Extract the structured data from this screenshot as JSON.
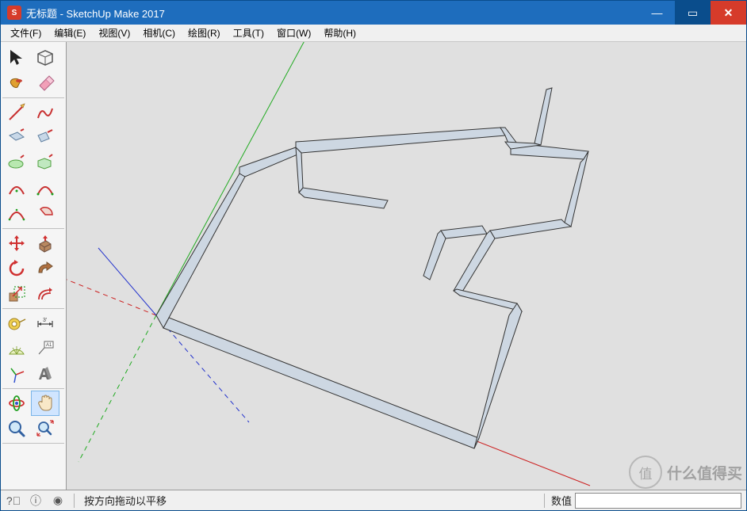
{
  "titlebar": {
    "text": "无标题 - SketchUp Make 2017",
    "icon_label": "S"
  },
  "menu": {
    "items": [
      "文件(F)",
      "编辑(E)",
      "视图(V)",
      "相机(C)",
      "绘图(R)",
      "工具(T)",
      "窗口(W)",
      "帮助(H)"
    ]
  },
  "statusbar": {
    "tip": "按方向拖动以平移",
    "value_label": "数值"
  },
  "watermark": {
    "circle_text": "值",
    "text": "什么值得买"
  }
}
